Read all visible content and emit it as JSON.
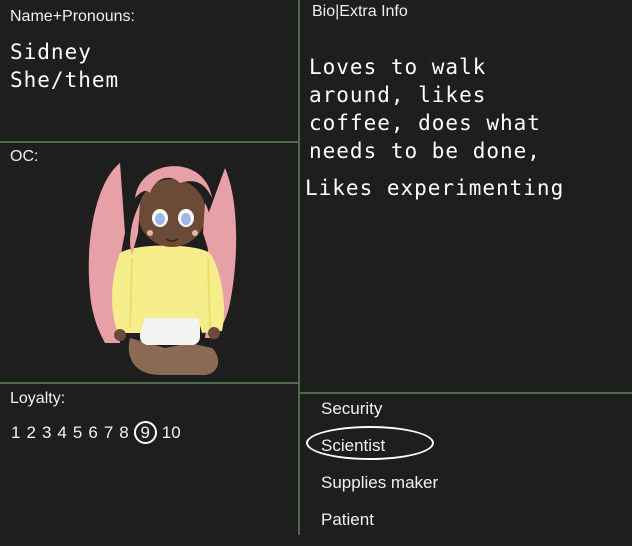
{
  "name_panel": {
    "label": "Name+Pronouns:",
    "name": "Sidney",
    "pronouns": "She/them"
  },
  "bio_panel": {
    "label": "Bio|Extra Info",
    "text_lines": [
      "Loves to walk",
      "around, likes",
      "coffee, does what",
      "needs to be done,"
    ],
    "extra_line": "Likes experimenting"
  },
  "oc_panel": {
    "label": "OC:"
  },
  "loyalty_panel": {
    "label": "Loyalty:",
    "scale": [
      "1",
      "2",
      "3",
      "4",
      "5",
      "6",
      "7",
      "8",
      "9",
      "10"
    ],
    "selected": 9
  },
  "roles": {
    "items": [
      "Security",
      "Scientist",
      "Supplies maker",
      "Patient"
    ],
    "selected": "Scientist"
  },
  "colors": {
    "background": "#1e1e1e",
    "divider": "#4e6a4a",
    "hair": "#e8a1a6",
    "hoodie": "#f6ee8a",
    "skin": "#6b4a38"
  }
}
